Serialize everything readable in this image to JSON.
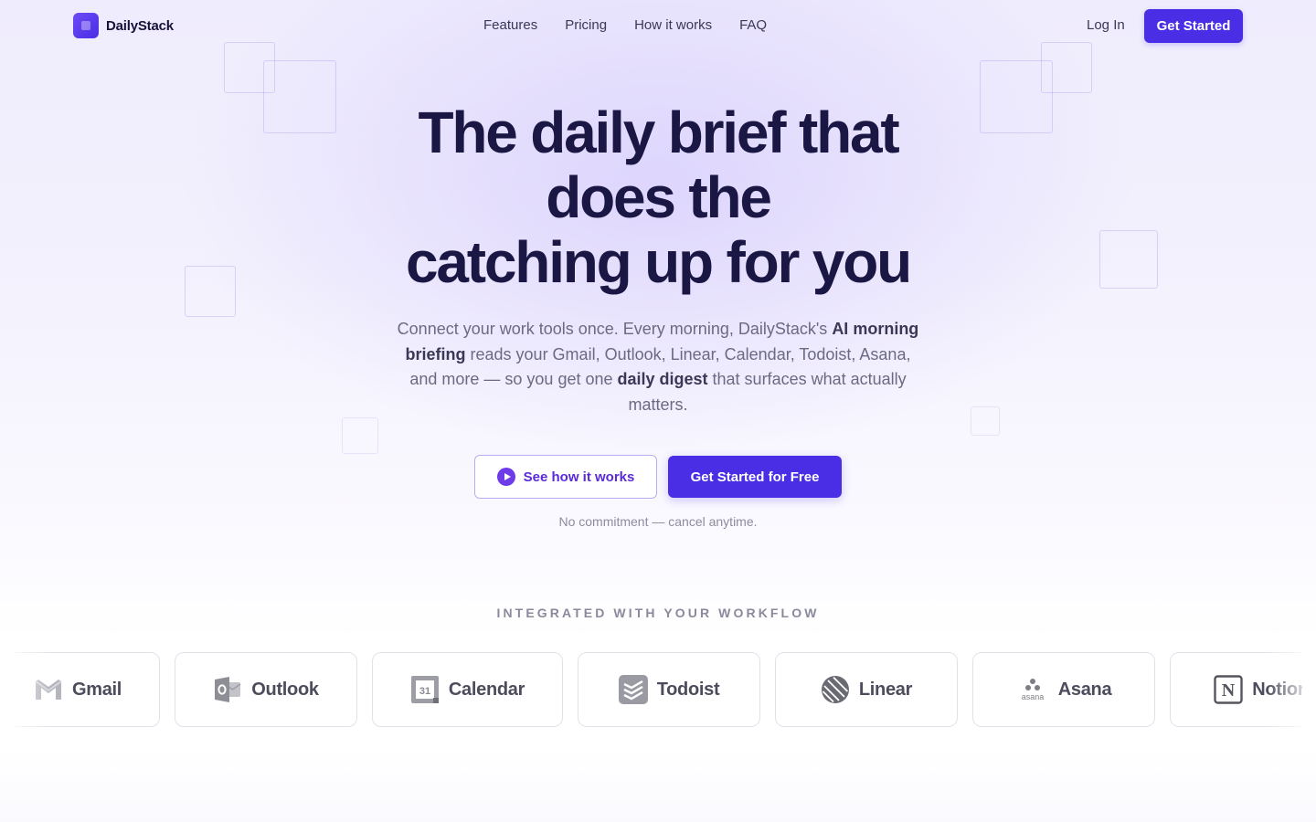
{
  "brand": {
    "name": "DailyStack",
    "accent": "#4a2ee6"
  },
  "nav": {
    "links": [
      "Features",
      "Pricing",
      "How it works",
      "FAQ"
    ],
    "login_label": "Log In",
    "cta_label": "Get Started"
  },
  "hero": {
    "title_line1": "The daily brief that",
    "title_line2": "does the",
    "title_line3": "catching up for you",
    "subtitle": {
      "part1": "Connect your work tools once. Every morning, DailyStack's ",
      "bold1": "AI morning briefing",
      "part2": " reads your Gmail, Outlook, Linear, Calendar, Todoist, Asana, and more — so you get one ",
      "bold2": "daily digest",
      "part3": " that surfaces what actually matters."
    },
    "secondary_cta": "See how it works",
    "primary_cta": "Get Started for Free",
    "note": "No commitment — cancel anytime."
  },
  "integrations": {
    "title": "INTEGRATED WITH YOUR WORKFLOW",
    "items": [
      {
        "label": "Gmail",
        "icon": "gmail-icon"
      },
      {
        "label": "Outlook",
        "icon": "outlook-icon"
      },
      {
        "label": "Calendar",
        "icon": "calendar-icon",
        "icon_text": "31"
      },
      {
        "label": "Todoist",
        "icon": "todoist-icon"
      },
      {
        "label": "Linear",
        "icon": "linear-icon"
      },
      {
        "label": "Asana",
        "icon": "asana-icon",
        "icon_text": "asana"
      },
      {
        "label": "Notion",
        "icon": "notion-icon",
        "icon_text": "N"
      }
    ]
  }
}
